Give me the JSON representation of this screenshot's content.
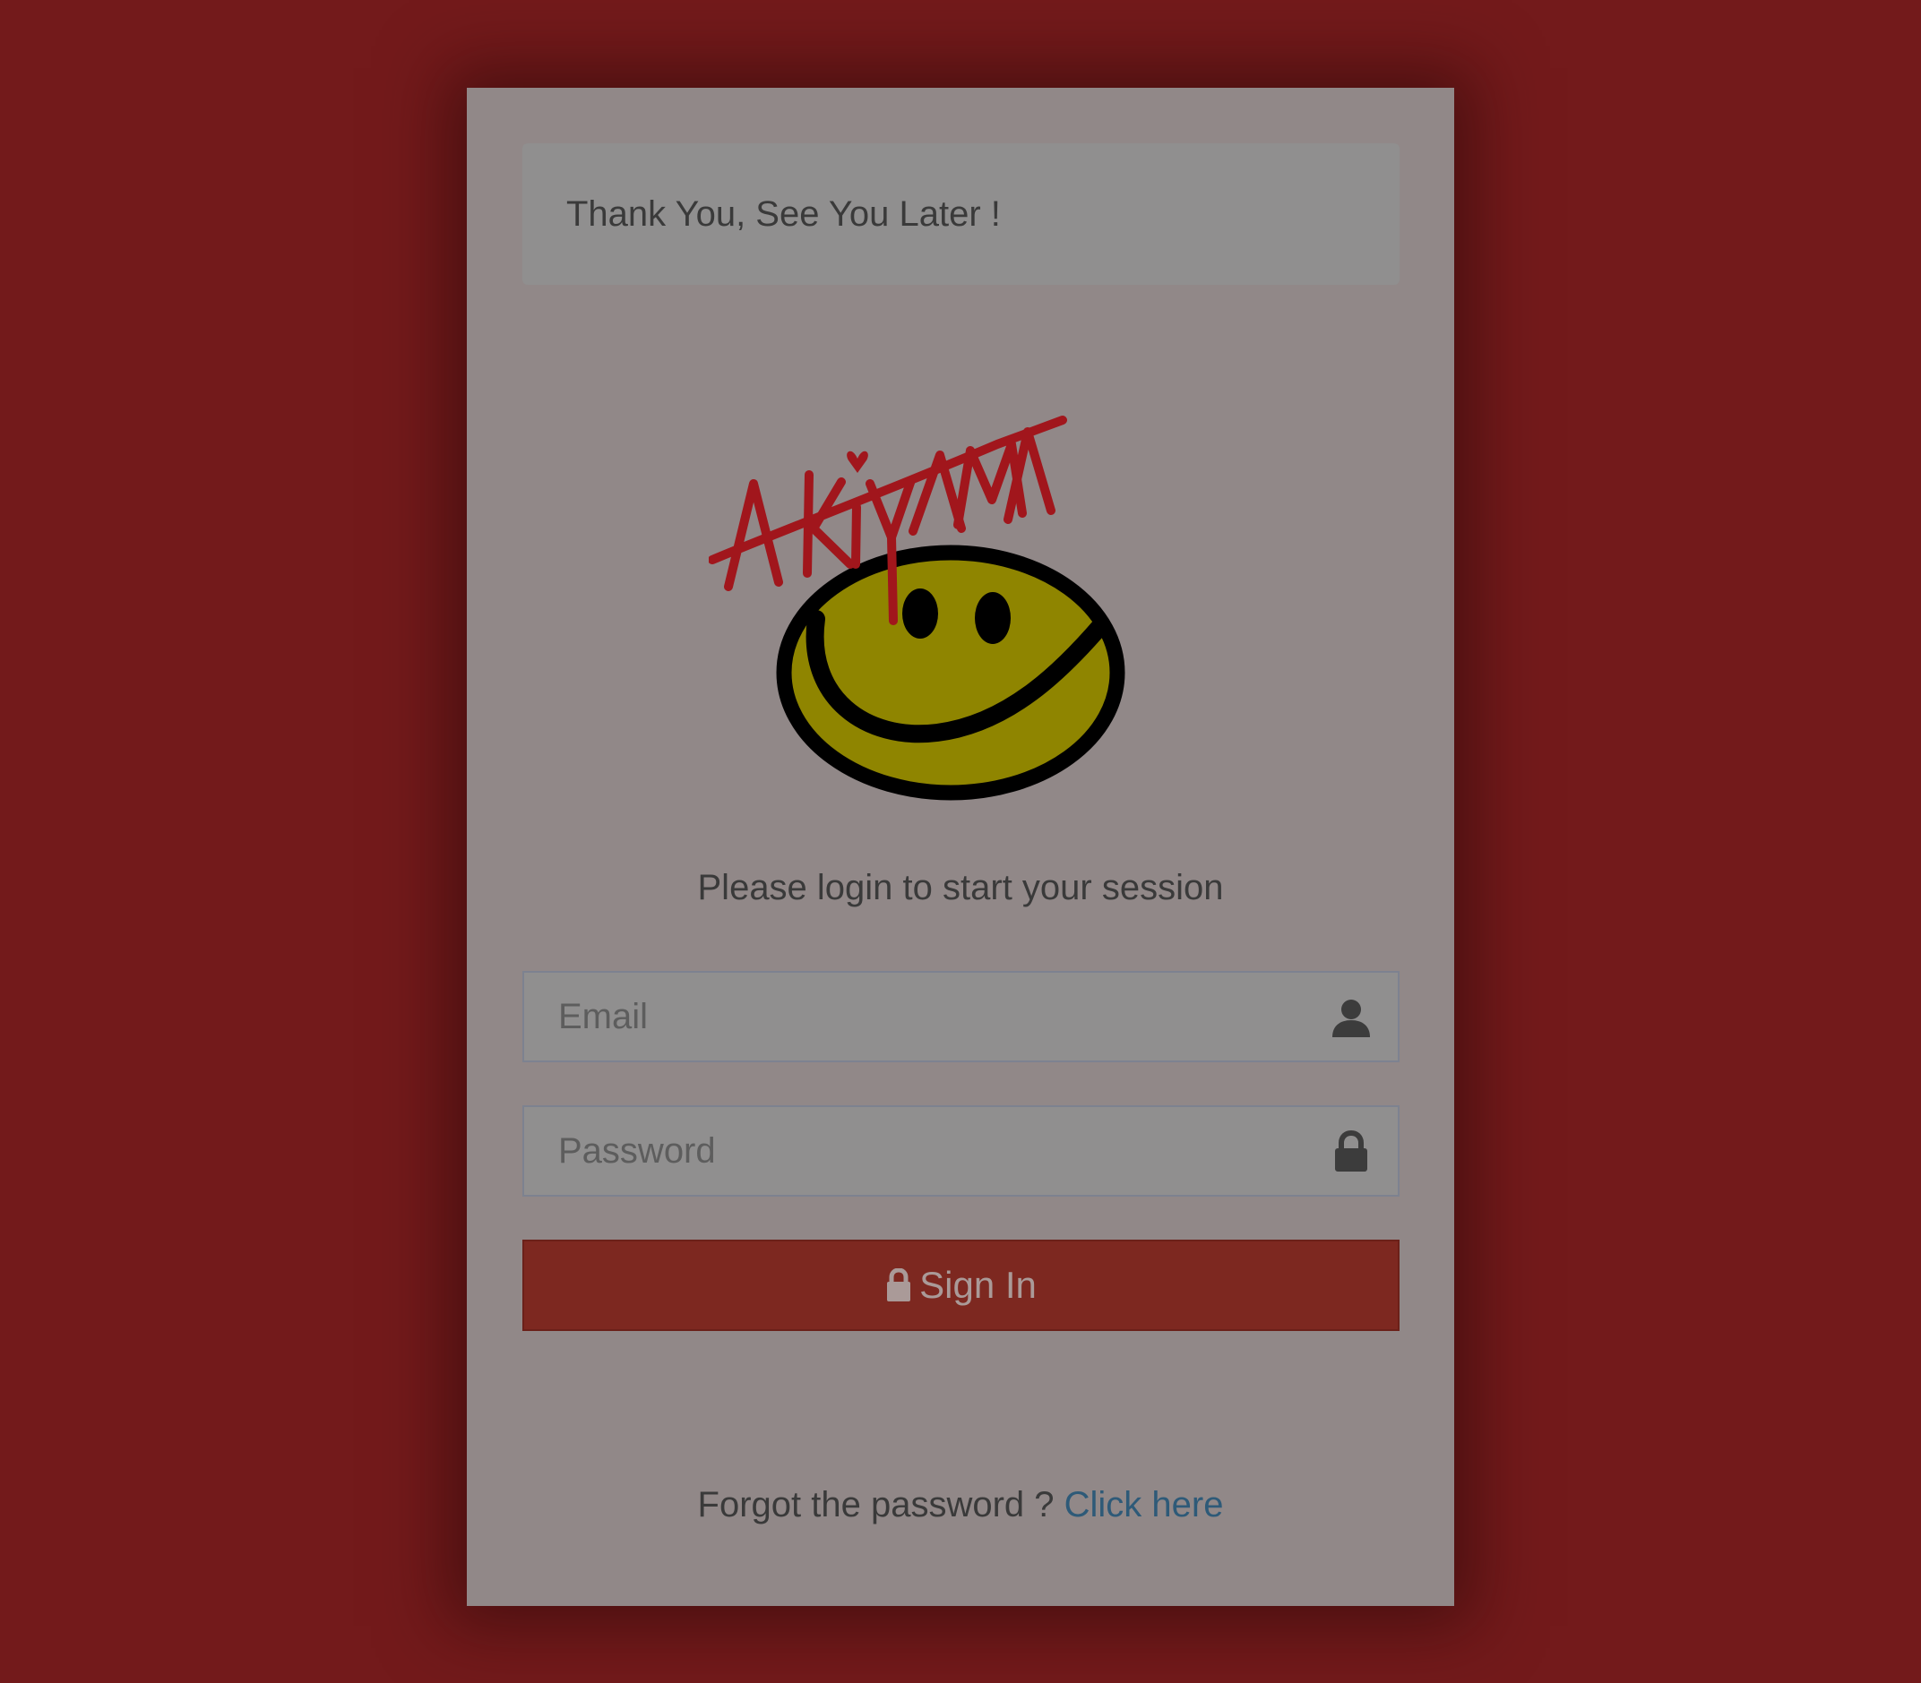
{
  "alert": {
    "message": "Thank You, See You Later !"
  },
  "logo": {
    "brand_text": "AKiYAMA",
    "icon": "smiley-face-logo"
  },
  "subtitle": "Please login to start your session",
  "email": {
    "placeholder": "Email",
    "value": "",
    "icon": "user-icon"
  },
  "password": {
    "placeholder": "Password",
    "value": "",
    "icon": "lock-icon"
  },
  "signin": {
    "label": "Sign In",
    "icon": "lock-icon"
  },
  "forgot": {
    "text": "Forgot the password ?",
    "link_label": "Click here"
  },
  "colors": {
    "background": "#731a1b",
    "card": "#918888",
    "button": "#7d2820",
    "link": "#2e5a78",
    "logo_red": "#a1161c",
    "logo_face": "#8f8500"
  }
}
